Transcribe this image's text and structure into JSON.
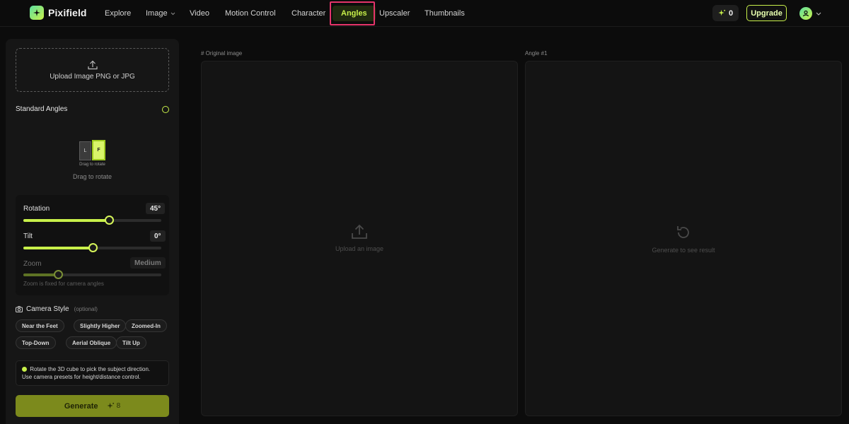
{
  "header": {
    "brand": "Pixifield",
    "nav": [
      {
        "label": "Explore",
        "has_dropdown": false
      },
      {
        "label": "Image",
        "has_dropdown": true
      },
      {
        "label": "Video",
        "has_dropdown": false
      },
      {
        "label": "Motion Control",
        "has_dropdown": false
      },
      {
        "label": "Character",
        "has_dropdown": false
      },
      {
        "label": "Angles",
        "has_dropdown": false,
        "active": true
      },
      {
        "label": "Upscaler",
        "has_dropdown": false
      },
      {
        "label": "Thumbnails",
        "has_dropdown": false
      }
    ],
    "credits": "0",
    "upgrade_label": "Upgrade"
  },
  "sidebar": {
    "upload_label": "Upload Image PNG or JPG",
    "standard_angles_label": "Standard Angles",
    "cube": {
      "left_face": "L",
      "front_face": "F",
      "caption_small": "Drag to rotate",
      "caption": "Drag to rotate"
    },
    "controls": {
      "rotation": {
        "label": "Rotation",
        "value": "45°",
        "fraction": 0.62
      },
      "tilt": {
        "label": "Tilt",
        "value": "0°",
        "fraction": 0.5
      },
      "zoom": {
        "label": "Zoom",
        "value": "Medium",
        "fraction": 0.25
      },
      "zoom_note": "Zoom is fixed for camera angles"
    },
    "camera_style": {
      "title": "Camera Style",
      "optional": "(optional)",
      "presets": [
        "Near the Feet",
        "Slightly Higher",
        "Zoomed-In",
        "Top-Down",
        "Aerial Oblique",
        "Tilt Up"
      ]
    },
    "tip_line1": "Rotate the 3D cube to pick the subject direction.",
    "tip_line2": "Use camera presets for height/distance control.",
    "generate": {
      "label": "Generate",
      "cost": "8"
    }
  },
  "main": {
    "original": {
      "title": "# Original image",
      "placeholder": "Upload an image"
    },
    "result": {
      "title": "Angle #1",
      "placeholder": "Generate to see result"
    }
  },
  "colors": {
    "accent": "#c8f04a",
    "highlight": "#e4346a",
    "background": "#0c0c0c"
  }
}
